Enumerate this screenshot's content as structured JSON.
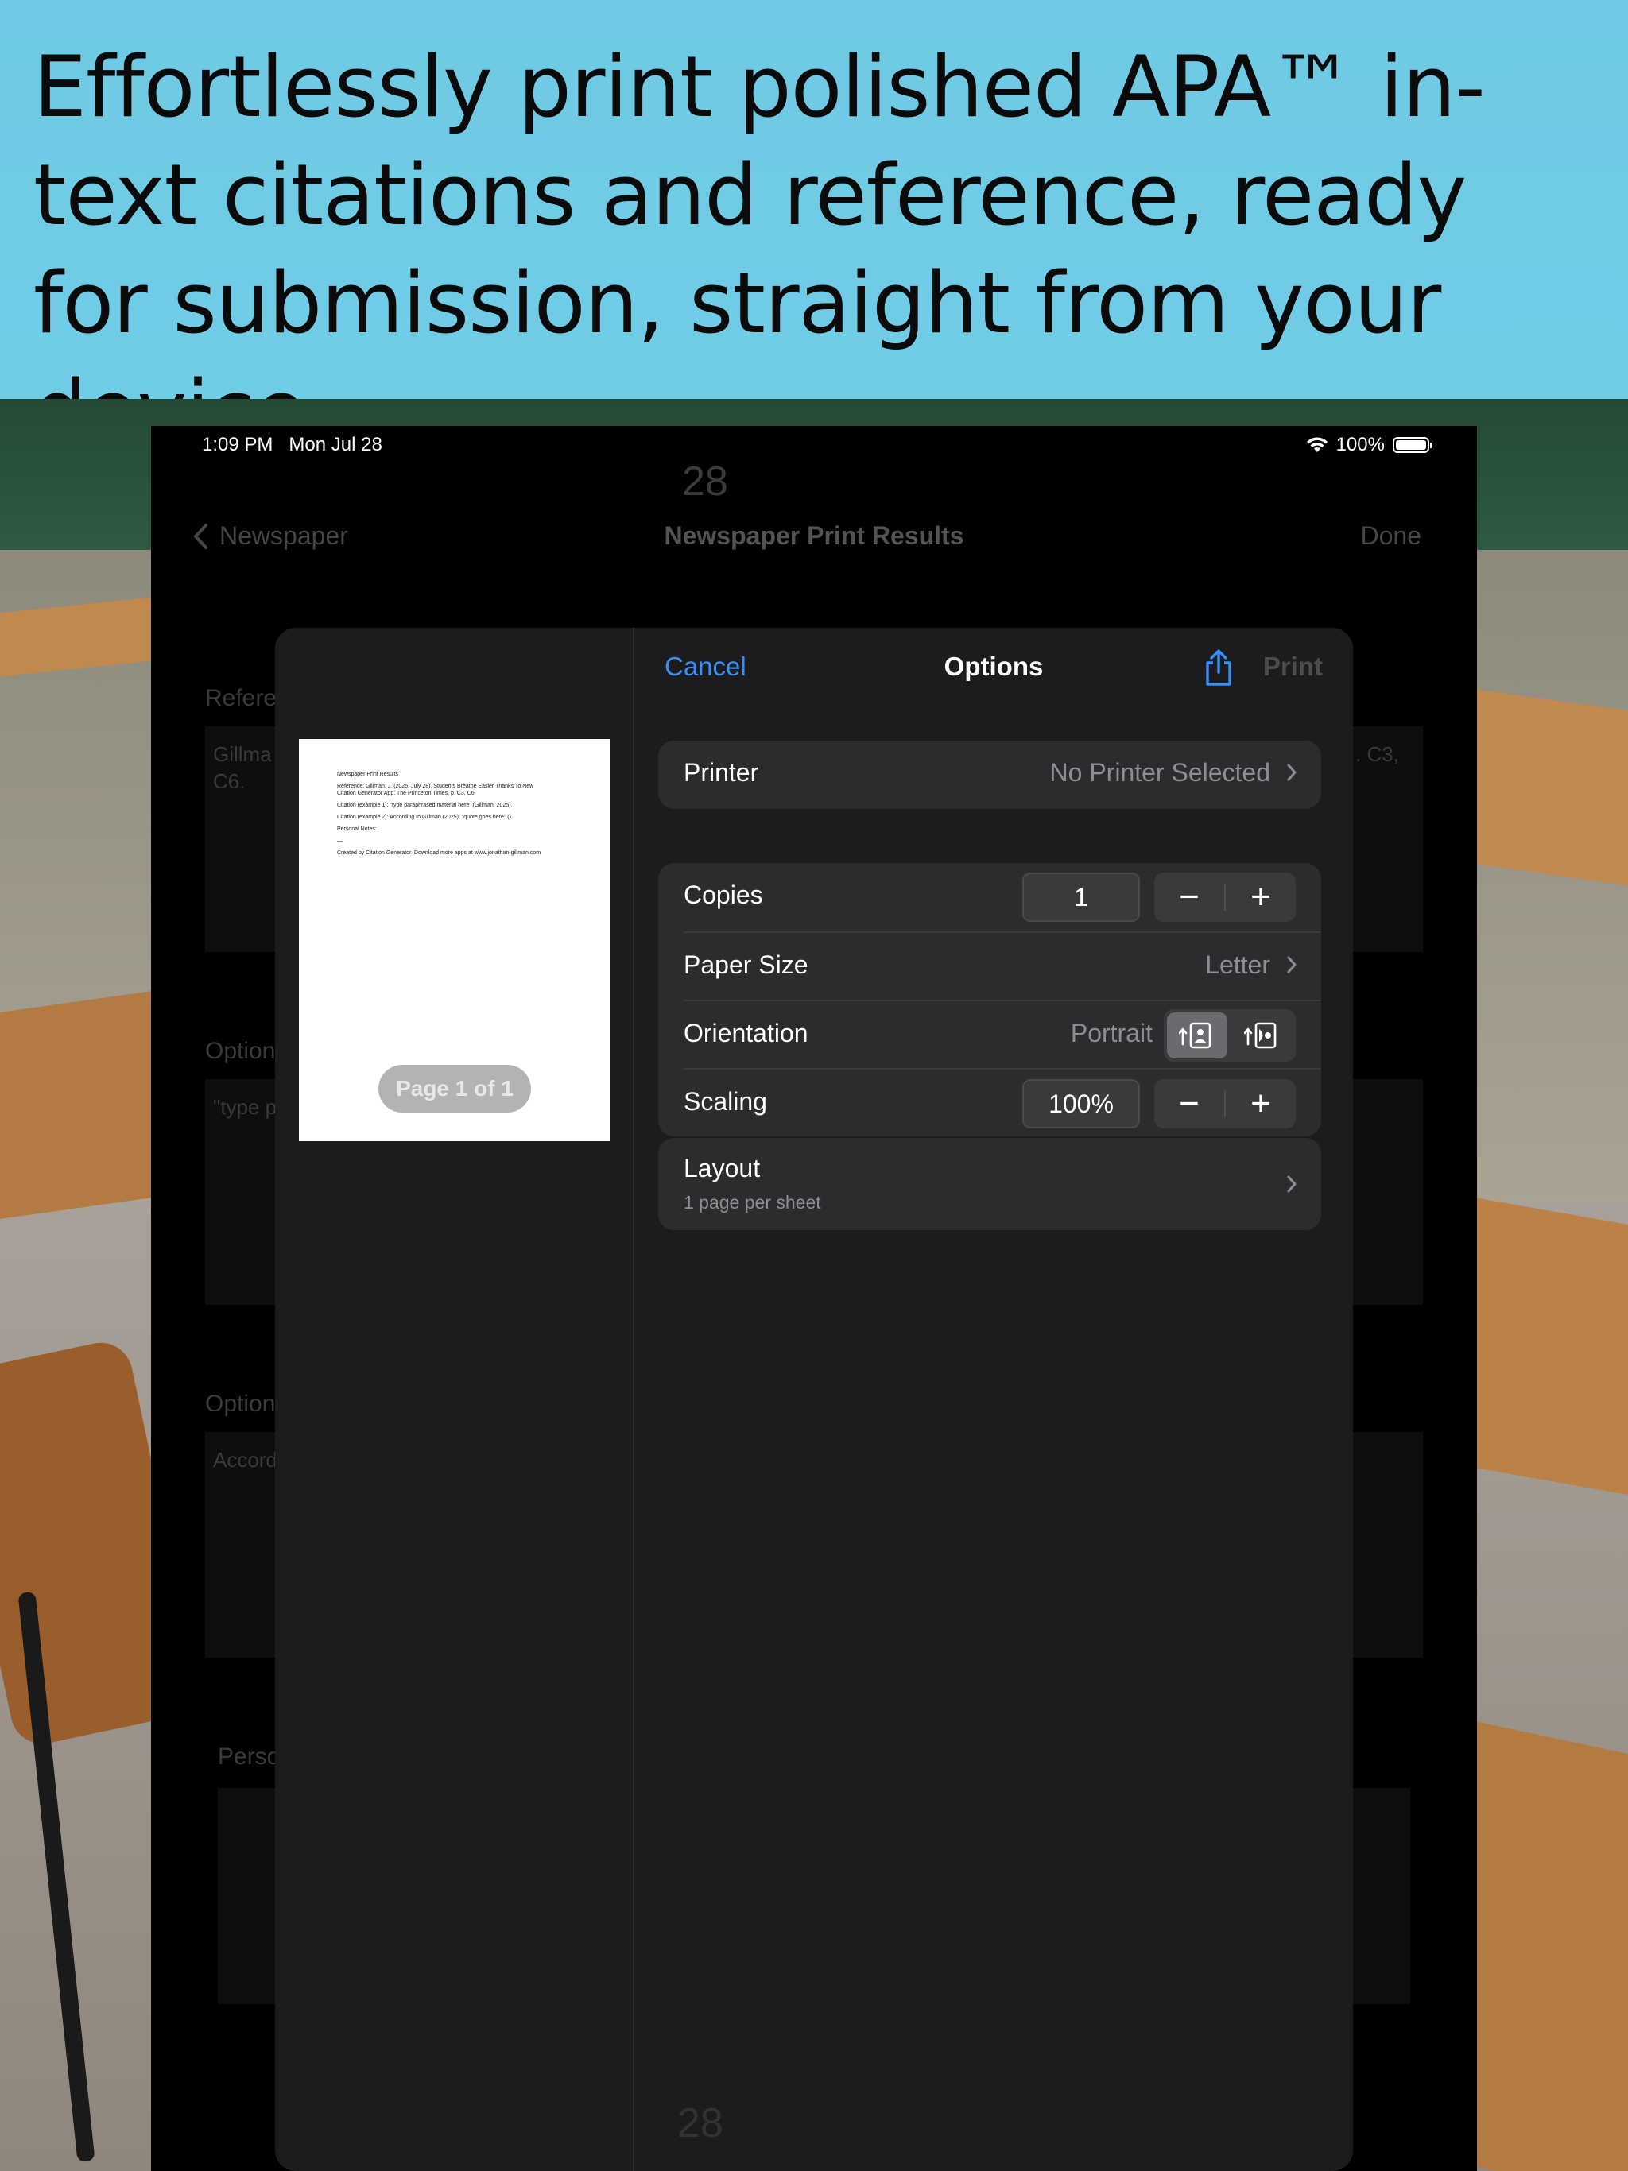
{
  "banner": {
    "headline": "Effortlessly print polished APA™ in-text citations and reference, ready for submission, straight from your device."
  },
  "status_bar": {
    "time": "1:09 PM",
    "date": "Mon Jul 28",
    "battery": "100%"
  },
  "background_app": {
    "date_number": "28",
    "nav": {
      "back_label": "Newspaper",
      "title": "Newspaper Print Results",
      "done_label": "Done"
    },
    "sections": [
      {
        "label": "Refere",
        "field_text": "Gillma",
        "field_text_2": "C6.",
        "field_text_right": ". C3,"
      },
      {
        "label": "Option",
        "field_text": "\"type p"
      },
      {
        "label": "Option",
        "field_text": "Accord"
      },
      {
        "label": "Perso",
        "field_text": ""
      }
    ],
    "bottom_date_number": "28"
  },
  "print_sheet": {
    "header": {
      "cancel_label": "Cancel",
      "title": "Options",
      "print_label": "Print"
    },
    "preview": {
      "page_indicator": "Page 1 of 1",
      "page_lines": [
        "Newspaper Print Results",
        "Reference: Gillman, J. (2025, July 28). Students Breathe Easier Thanks To New Citation Generator App. The Princeton Times, p. C3, C6.",
        "Citation (example 1): \"type paraphrased material here\" (Gillman, 2025).",
        "Citation (example 2): According to Gillman (2025), \"quote goes here\" ().",
        "Personal Notes:",
        "—",
        "Created by Citation Generator. Download more apps at www.jonathan-gillman.com"
      ]
    },
    "printer": {
      "label": "Printer",
      "value": "No Printer Selected"
    },
    "copies": {
      "label": "Copies",
      "value": "1",
      "minus": "−",
      "plus": "+"
    },
    "paper_size": {
      "label": "Paper Size",
      "value": "Letter"
    },
    "orientation": {
      "label": "Orientation",
      "value": "Portrait"
    },
    "scaling": {
      "label": "Scaling",
      "value": "100%",
      "minus": "−",
      "plus": "+"
    },
    "layout": {
      "label": "Layout",
      "sub": "1 page per sheet"
    }
  },
  "colors": {
    "accent": "#3a8ff7",
    "banner": "#6fc9e4",
    "sheet_bg": "#1c1c1e",
    "row_bg": "#2c2c2e"
  }
}
